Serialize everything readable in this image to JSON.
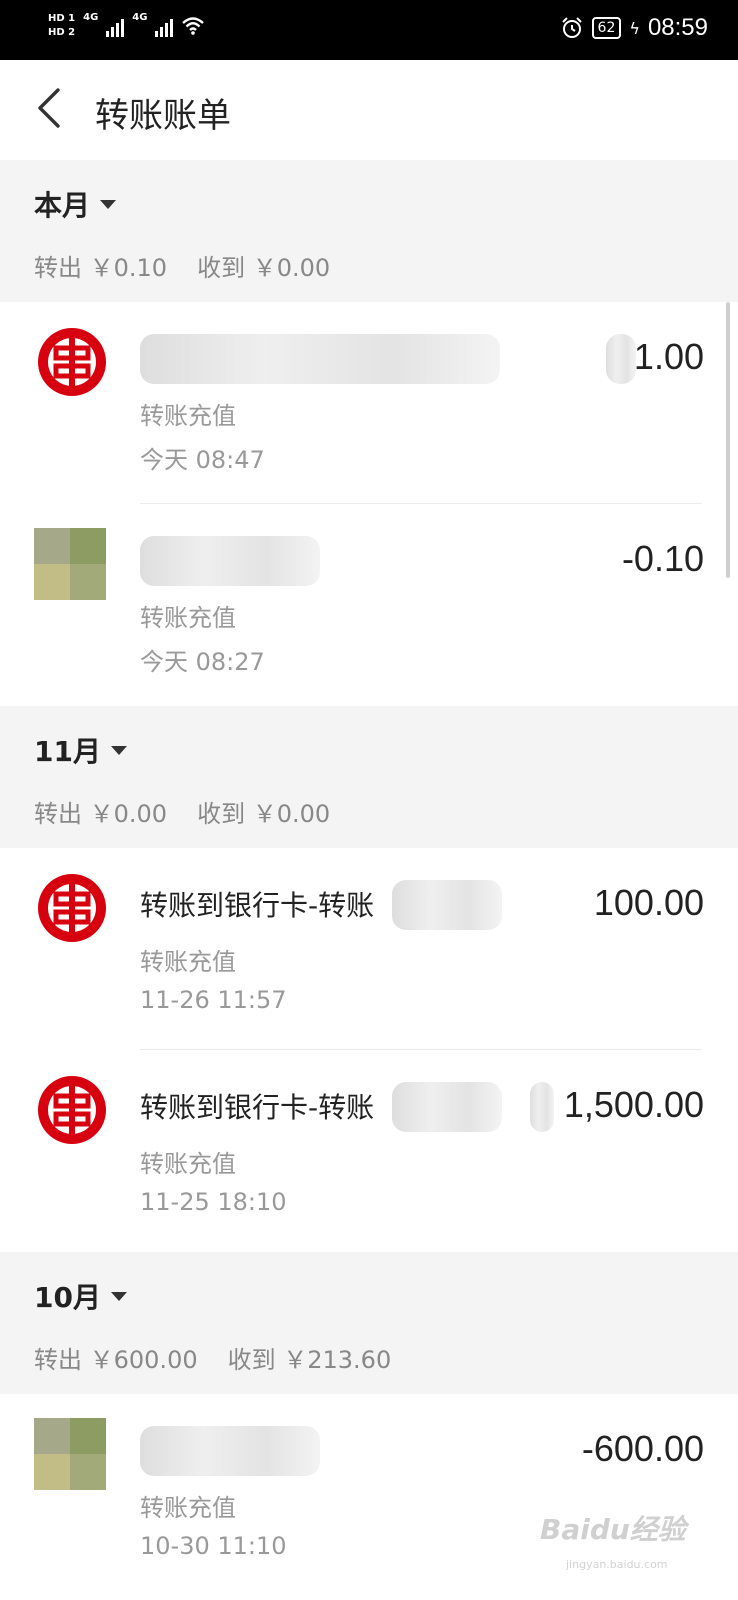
{
  "status_bar": {
    "hd1": "HD 1",
    "hd2": "HD 2",
    "net1": "4G",
    "net2": "4G",
    "battery": "62",
    "time": "08:59",
    "icons": [
      "signal-icon",
      "wifi-icon",
      "alarm-icon",
      "battery-icon",
      "charging-icon"
    ]
  },
  "header": {
    "title": "转账账单",
    "back_icon": "chevron-left-icon"
  },
  "months": [
    {
      "label": "本月",
      "out": "转出 ￥0.10",
      "in": "收到 ￥0.00"
    },
    {
      "label": "11月",
      "out": "转出 ￥0.00",
      "in": "收到 ￥0.00"
    },
    {
      "label": "10月",
      "out": "转出 ￥600.00",
      "in": "收到 ￥213.60"
    }
  ],
  "transactions": [
    {
      "name": "",
      "category": "转账充值",
      "time": "今天  08:47",
      "amount": "1.00",
      "avatar": "icbc-bank-logo"
    },
    {
      "name": "",
      "category": "转账充值",
      "time": "今天  08:27",
      "amount": "-0.10",
      "avatar": "user-photo"
    },
    {
      "name": "转账到银行卡-转账",
      "category": "转账充值",
      "time": "11-26  11:57",
      "amount": "100.00",
      "avatar": "icbc-bank-logo"
    },
    {
      "name": "转账到银行卡-转账",
      "category": "转账充值",
      "time": "11-25  18:10",
      "amount": "1,500.00",
      "avatar": "icbc-bank-logo"
    },
    {
      "name": "",
      "category": "转账充值",
      "time": "10-30  11:10",
      "amount": "-600.00",
      "avatar": "user-photo"
    }
  ],
  "watermark": {
    "brand": "Baidu经验",
    "url": "jingyan.baidu.com"
  },
  "colors": {
    "icbc_red": "#d7000f",
    "page_bg": "#f4f4f4",
    "secondary_text": "#999999"
  }
}
